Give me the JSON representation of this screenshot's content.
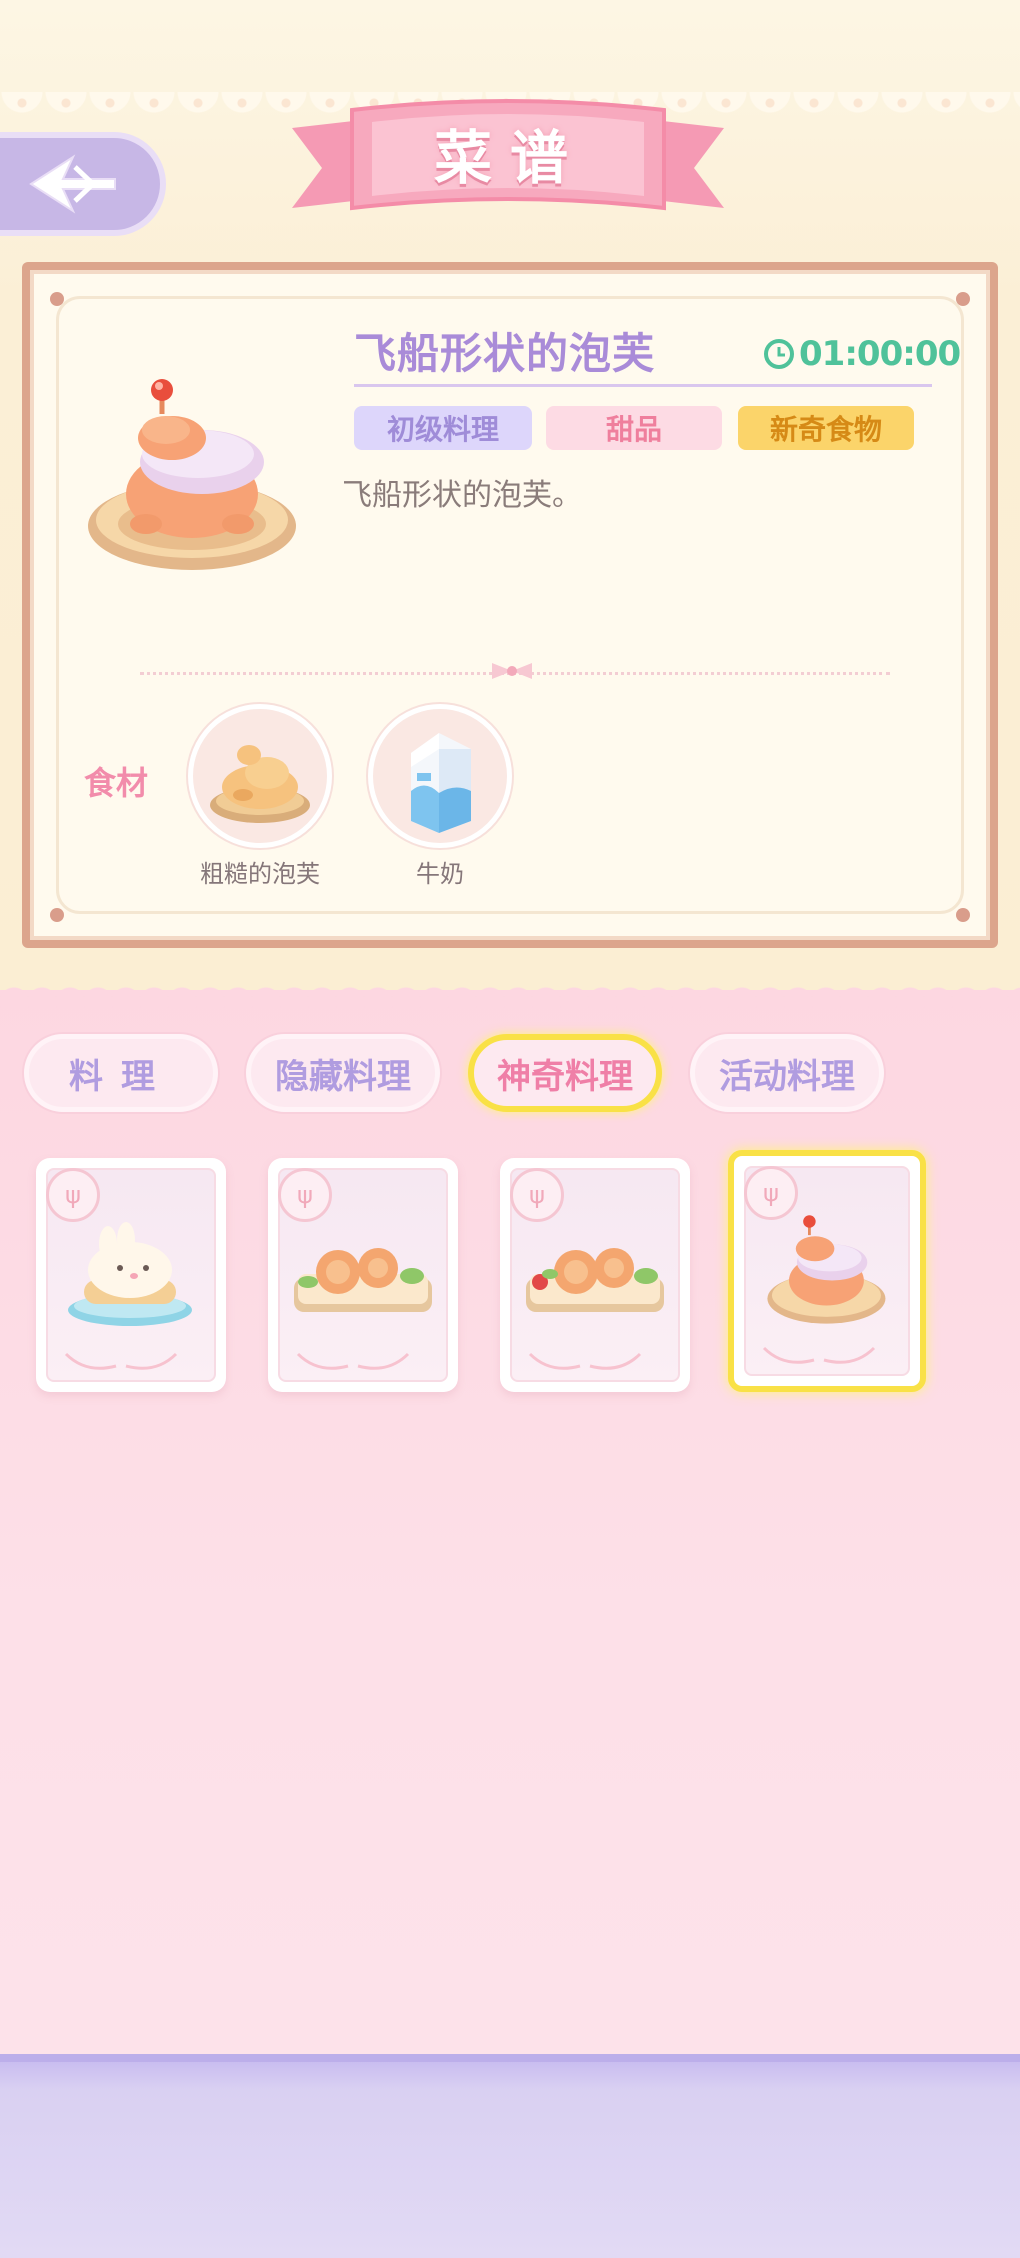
{
  "header": {
    "title": "菜谱"
  },
  "recipe": {
    "name": "飞船形状的泡芙",
    "time": "01:00:00",
    "tags": [
      "初级料理",
      "甜品",
      "新奇食物"
    ],
    "description": "飞船形状的泡芙。",
    "ingredients_label": "食材",
    "ingredients": [
      {
        "name": "粗糙的泡芙",
        "icon": "rough-puff-icon"
      },
      {
        "name": "牛奶",
        "icon": "milk-carton-icon"
      }
    ]
  },
  "tabs": [
    {
      "label": "料理",
      "active": false
    },
    {
      "label": "隐藏料理",
      "active": false
    },
    {
      "label": "神奇料理",
      "active": true
    },
    {
      "label": "活动料理",
      "active": false
    }
  ],
  "recipe_list": [
    {
      "icon": "bunny-pancake-icon",
      "selected": false
    },
    {
      "icon": "rolls-plate-icon",
      "selected": false
    },
    {
      "icon": "rolls-plate-berry-icon",
      "selected": false
    },
    {
      "icon": "spaceship-puff-icon",
      "selected": true
    }
  ],
  "colors": {
    "accent_lavender": "#a98bd8",
    "accent_pink": "#ef7f9d",
    "accent_yellow": "#f9e146",
    "timer_green": "#4fc29a"
  }
}
